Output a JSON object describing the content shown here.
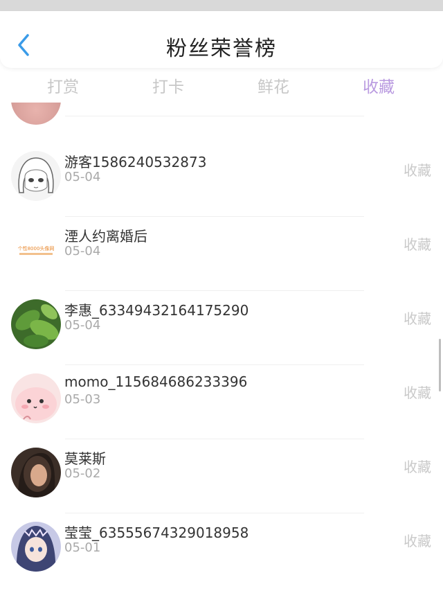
{
  "header": {
    "title": "粉丝荣誉榜",
    "back_icon": "chevron-left-icon",
    "accent": "#3a9be8"
  },
  "tabs": [
    {
      "label": "打赏",
      "active": false
    },
    {
      "label": "打卡",
      "active": false
    },
    {
      "label": "鲜花",
      "active": false
    },
    {
      "label": "收藏",
      "active": true
    }
  ],
  "active_tab_color": "#b99ae0",
  "rows": [
    {
      "name": "游客1586240532873",
      "date": "05-04",
      "action": "收藏",
      "avatar": "anime-girl-sketch"
    },
    {
      "name": "湮人约离婚后",
      "date": "05-04",
      "action": "收藏",
      "avatar": "orange-text-logo",
      "avatar_text": "个性8000头像网"
    },
    {
      "name": "李惠_63349432164175290",
      "date": "05-04",
      "action": "收藏",
      "avatar": "green-leaves"
    },
    {
      "name": "momo_115684686233396",
      "date": "05-03",
      "action": "收藏",
      "avatar": "pink-cartoon"
    },
    {
      "name": "莫莱斯",
      "date": "05-02",
      "action": "收藏",
      "avatar": "dark-portrait"
    },
    {
      "name": "莹莹_63555674329018958",
      "date": "05-01",
      "action": "收藏",
      "avatar": "anime-girl-blue"
    }
  ]
}
